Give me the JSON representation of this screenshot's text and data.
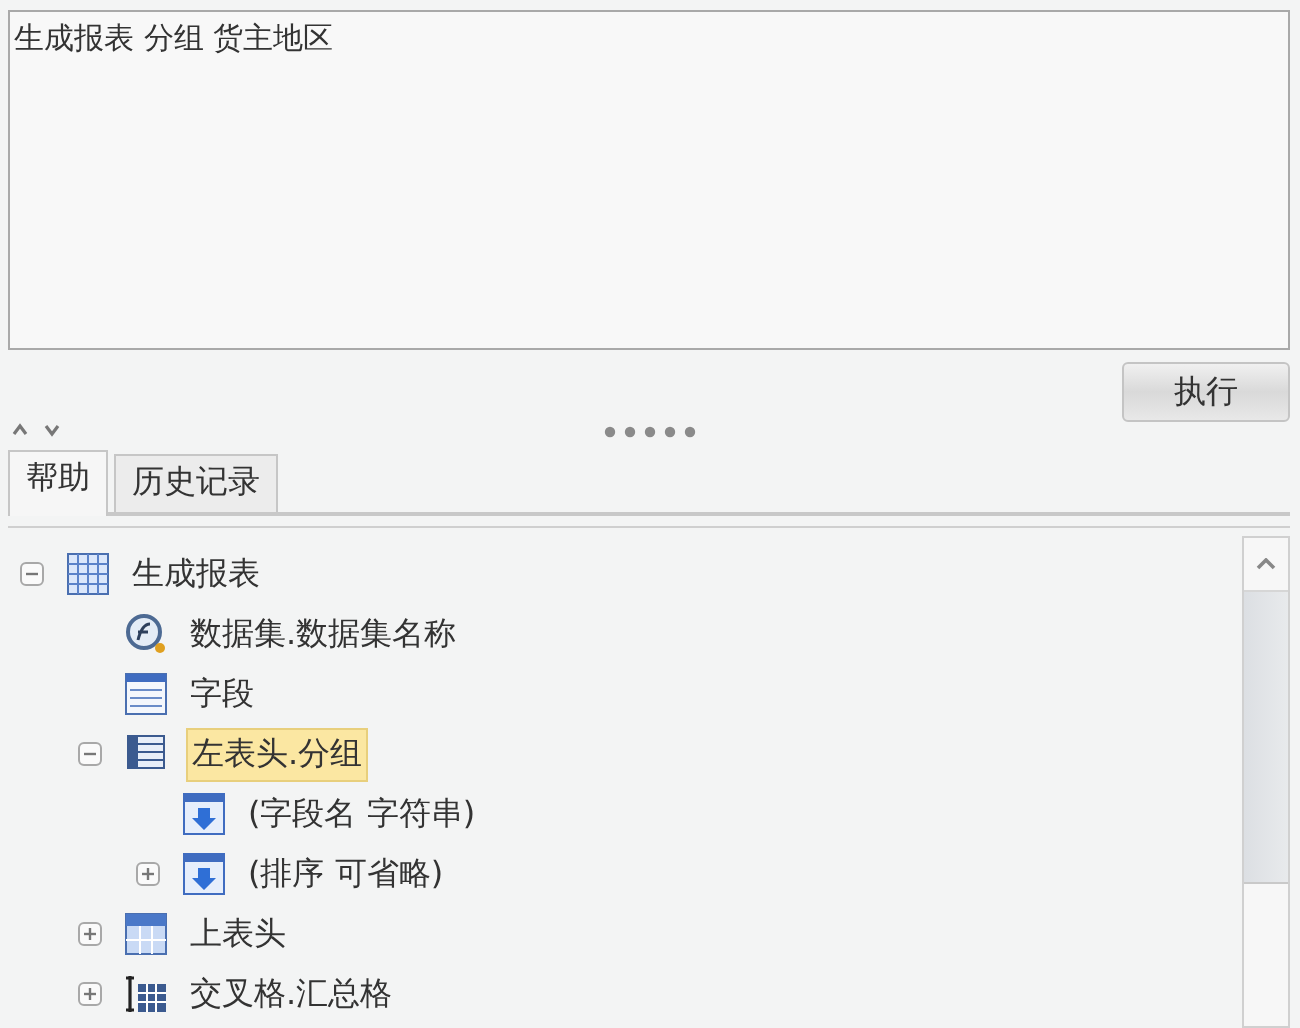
{
  "editor": {
    "value": "生成报表 分组 货主地区"
  },
  "run_button": {
    "label": "执行"
  },
  "tabs": [
    {
      "label": "帮助",
      "selected": true
    },
    {
      "label": "历史记录",
      "selected": false
    }
  ],
  "tree": [
    {
      "label": "生成报表",
      "kind": "grid",
      "expanded": true,
      "selected": false,
      "children": [
        {
          "label": "数据集.数据集名称",
          "kind": "function",
          "selected": false
        },
        {
          "label": "字段",
          "kind": "list",
          "selected": false
        },
        {
          "label": "左表头.分组",
          "kind": "rows",
          "expanded": true,
          "selected": true,
          "children": [
            {
              "label": "(字段名 字符串)",
              "kind": "sort",
              "selected": false
            },
            {
              "label": "(排序 可省略)",
              "kind": "sort",
              "expanded": false,
              "selected": false
            }
          ]
        },
        {
          "label": "上表头",
          "kind": "header",
          "expanded": false,
          "selected": false
        },
        {
          "label": "交叉格.汇总格",
          "kind": "cross",
          "expanded": false,
          "selected": false
        }
      ]
    }
  ]
}
